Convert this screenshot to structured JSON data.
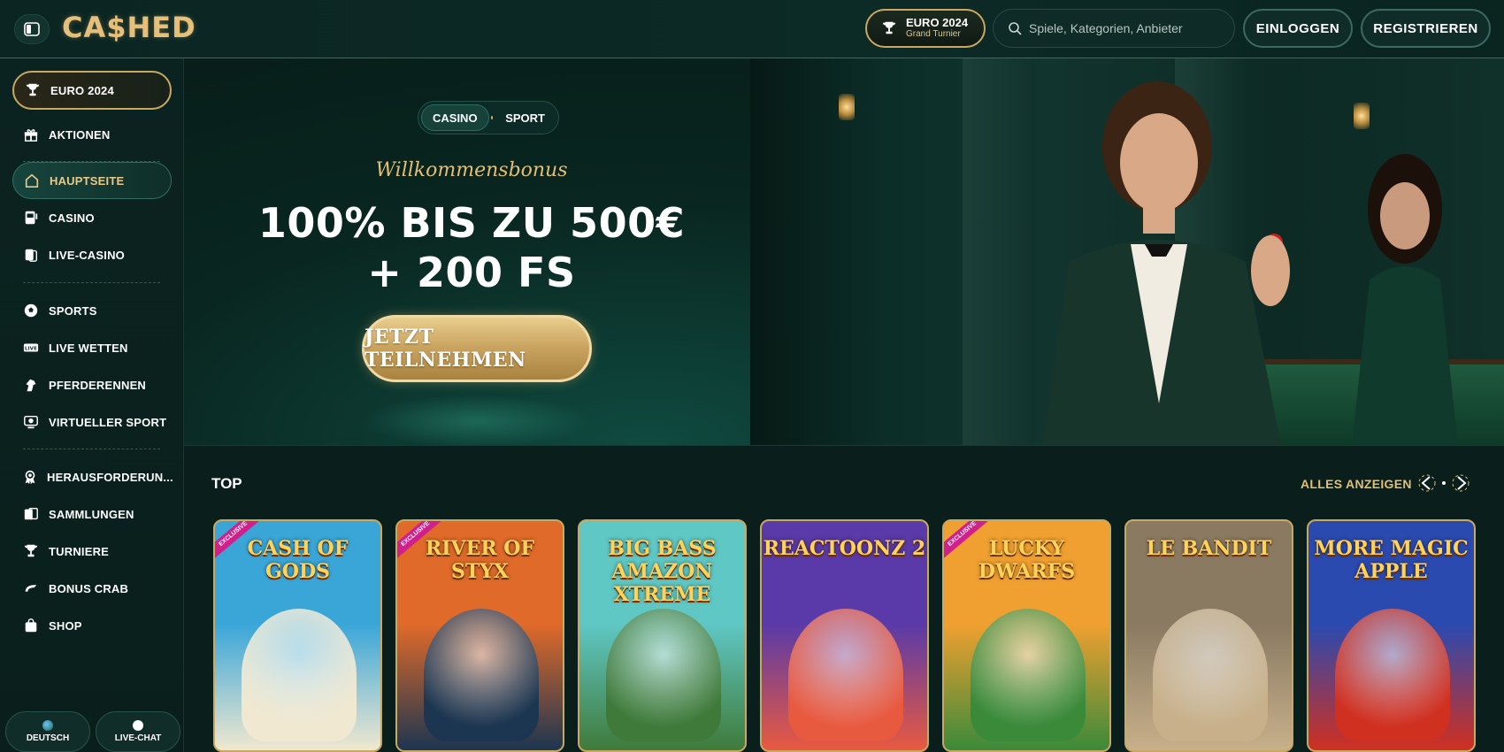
{
  "header": {
    "logo": "CA$HED",
    "euro_title": "EURO 2024",
    "euro_subtitle": "Grand Turnier",
    "search_placeholder": "Spiele, Kategorien, Anbieter",
    "login_label": "EINLOGGEN",
    "register_label": "REGISTRIEREN"
  },
  "sidebar": {
    "items": [
      {
        "label": "EURO 2024",
        "icon": "trophy-icon"
      },
      {
        "label": "AKTIONEN",
        "icon": "gift-icon"
      },
      {
        "label": "HAUPTSEITE",
        "icon": "home-icon"
      },
      {
        "label": "CASINO",
        "icon": "slot-machine-icon"
      },
      {
        "label": "LIVE-CASINO",
        "icon": "cards-icon"
      },
      {
        "label": "SPORTS",
        "icon": "soccer-ball-icon"
      },
      {
        "label": "LIVE WETTEN",
        "icon": "live-icon"
      },
      {
        "label": "PFERDERENNEN",
        "icon": "horse-icon"
      },
      {
        "label": "VIRTUELLER SPORT",
        "icon": "virtual-sport-icon"
      },
      {
        "label": "HERAUSFORDERUN...",
        "icon": "challenge-icon"
      },
      {
        "label": "SAMMLUNGEN",
        "icon": "collections-icon"
      },
      {
        "label": "TURNIERE",
        "icon": "trophy-icon"
      },
      {
        "label": "BONUS CRAB",
        "icon": "crab-icon"
      },
      {
        "label": "SHOP",
        "icon": "shop-bag-icon"
      }
    ],
    "language_label": "DEUTSCH",
    "chat_label": "LIVE-CHAT"
  },
  "hero": {
    "tab_casino": "CASINO",
    "tab_sport": "SPORT",
    "welcome": "Willkommensbonus",
    "headline_line1": "100% BIS ZU 500€",
    "headline_line2": "+ 200 FS",
    "cta_label": "JETZT TEILNEHMEN"
  },
  "top": {
    "title": "TOP",
    "see_all": "ALLES ANZEIGEN",
    "exclusive_label": "EXCLUSIVE",
    "games": [
      {
        "title": "CASH OF GODS",
        "exclusive": true,
        "bg": "#3aa6d8",
        "bg2": "#f0e8d0"
      },
      {
        "title": "RIVER OF STYX",
        "exclusive": true,
        "bg": "#e06a2a",
        "bg2": "#1c3550"
      },
      {
        "title": "BIG BASS AMAZON XTREME",
        "exclusive": false,
        "bg": "#5fc7c4",
        "bg2": "#3f7a3a"
      },
      {
        "title": "REACTOONZ 2",
        "exclusive": false,
        "bg": "#5a3aa8",
        "bg2": "#e85a40"
      },
      {
        "title": "LUCKY DWARFS",
        "exclusive": true,
        "bg": "#f0a030",
        "bg2": "#3a8a3a"
      },
      {
        "title": "LE BANDIT",
        "exclusive": false,
        "bg": "#8a7a62",
        "bg2": "#c7b08a"
      },
      {
        "title": "MORE MAGIC APPLE",
        "exclusive": false,
        "bg": "#2a4ab0",
        "bg2": "#d03020"
      }
    ]
  },
  "colors": {
    "gold": "#c9a862",
    "bg_dark": "#0b1f1c",
    "accent_green": "#17423a"
  }
}
